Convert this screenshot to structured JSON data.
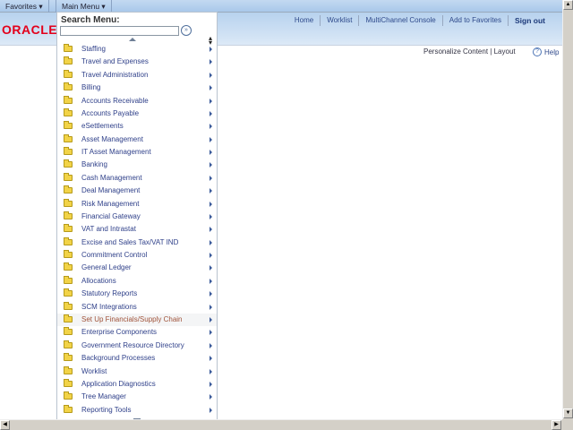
{
  "topbar": {
    "favorites": "Favorites",
    "main_menu": "Main Menu"
  },
  "header": {
    "logo": "ORACLE",
    "nav": [
      "Home",
      "Worklist",
      "MultiChannel Console",
      "Add to Favorites"
    ],
    "sign_out": "Sign out"
  },
  "page": {
    "personalize": "Personalize Content",
    "separator": "|",
    "layout": "Layout",
    "help": "Help"
  },
  "menu": {
    "search_title": "Search Menu:",
    "search_value": "",
    "go_icon": "»",
    "items": [
      "Staffing",
      "Travel and Expenses",
      "Travel Administration",
      "Billing",
      "Accounts Receivable",
      "Accounts Payable",
      "eSettlements",
      "Asset Management",
      "IT Asset Management",
      "Banking",
      "Cash Management",
      "Deal Management",
      "Risk Management",
      "Financial Gateway",
      "VAT and Intrastat",
      "Excise and Sales Tax/VAT IND",
      "Commitment Control",
      "General Ledger",
      "Allocations",
      "Statutory Reports",
      "SCM Integrations",
      "Set Up Financials/Supply Chain",
      "Enterprise Components",
      "Government Resource Directory",
      "Background Processes",
      "Worklist",
      "Application Diagnostics",
      "Tree Manager",
      "Reporting Tools"
    ],
    "highlighted": "Set Up Financials/Supply Chain"
  },
  "colors": {
    "logo": "#e3001b",
    "link": "#30418a",
    "highlight_text": "#a0533a"
  }
}
